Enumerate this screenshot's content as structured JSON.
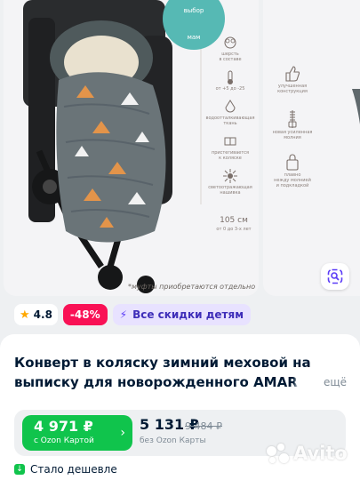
{
  "gallery": {
    "badge": {
      "top": "выбор",
      "bottom": "мам"
    },
    "features": [
      {
        "icon": "sheep-icon",
        "text": "шерсть\nв составе"
      },
      {
        "icon": "thermometer-icon",
        "text": "от +5 до -25"
      },
      {
        "icon": "water-drop-icon",
        "text": "водоотталкивающая\nткань"
      },
      {
        "icon": "stroller-fit-icon",
        "text": "пристегивается\nк коляске"
      },
      {
        "icon": "reflective-icon",
        "text": "светоотражающая\nнашивка"
      }
    ],
    "size": {
      "height": "105 см",
      "age": "от 0 до 3-х лет"
    },
    "muff_note": "*муфты приобретаются отдельно",
    "side_features": [
      {
        "icon": "thumbs-up-icon",
        "text": "улучшенная\nконструкция"
      },
      {
        "icon": "zipper-icon",
        "text": "новая усиленная\nмолния"
      },
      {
        "icon": "lock-icon",
        "text": "плавно\nнежду молнией\nи подкладкой"
      }
    ]
  },
  "chips": {
    "rating": "4.8",
    "discount": "-48%",
    "promo": "Все скидки детям"
  },
  "product": {
    "title_main": "Конверт в коляску зимний меховой на выписку для новорожденного AMA",
    "title_fade": "R",
    "more": "ещё"
  },
  "price": {
    "ozon_value": "4 971 ₽",
    "ozon_label": "с Ozon Картой",
    "regular_value": "5 131 ₽",
    "old_value": "9 484 ₽",
    "regular_label": "без Ozon Карты"
  },
  "status": {
    "cheaper": "Стало дешевле"
  },
  "watermark": "Avito",
  "colors": {
    "ozon_green": "#10c44c",
    "discount_pink": "#f91155",
    "promo_bg": "#e8e2ff",
    "text_dark": "#001a34",
    "badge_teal": "#56b9b4"
  }
}
